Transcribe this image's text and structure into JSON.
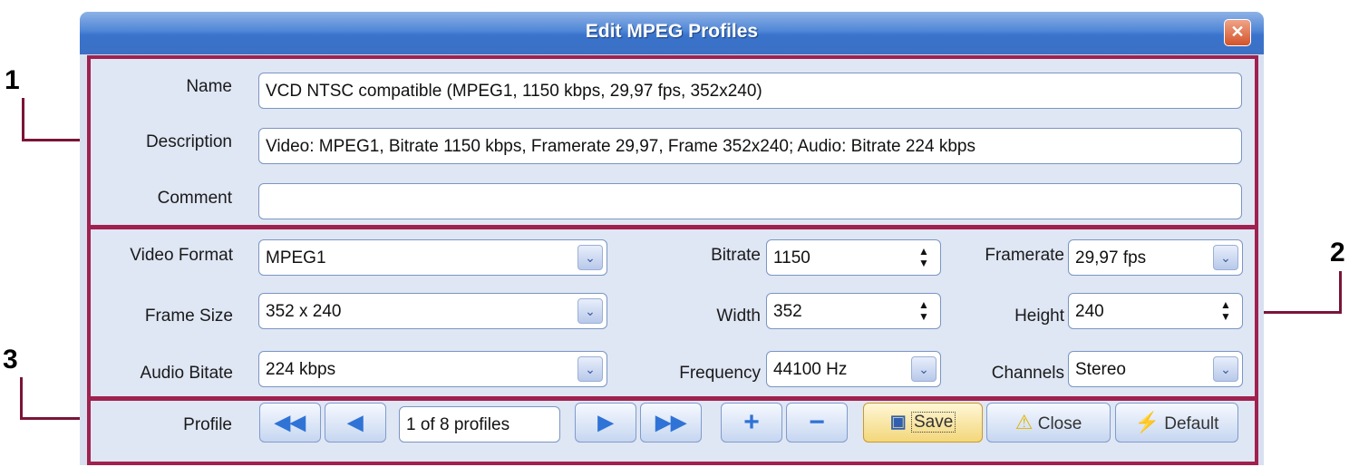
{
  "callouts": {
    "one": "1",
    "two": "2",
    "three": "3"
  },
  "window": {
    "title": "Edit MPEG Profiles",
    "close_glyph": "✕"
  },
  "info": {
    "name_label": "Name",
    "name_value": "VCD NTSC compatible (MPEG1, 1150 kbps, 29,97 fps, 352x240)",
    "description_label": "Description",
    "description_value": "Video: MPEG1, Bitrate 1150 kbps, Framerate 29,97, Frame 352x240; Audio: Bitrate 224 kbps",
    "comment_label": "Comment",
    "comment_value": ""
  },
  "settings": {
    "video_format_label": "Video Format",
    "video_format_value": "MPEG1",
    "bitrate_label": "Bitrate",
    "bitrate_value": "1150",
    "framerate_label": "Framerate",
    "framerate_value": "29,97 fps",
    "frame_size_label": "Frame Size",
    "frame_size_value": "352 x 240",
    "width_label": "Width",
    "width_value": "352",
    "height_label": "Height",
    "height_value": "240",
    "audio_bitate_label": "Audio Bitate",
    "audio_bitate_value": "224 kbps",
    "frequency_label": "Frequency",
    "frequency_value": "44100 Hz",
    "channels_label": "Channels",
    "channels_value": "Stereo"
  },
  "profile": {
    "label": "Profile",
    "counter": "1 of 8 profiles",
    "save_label": "Save",
    "close_label": "Close",
    "default_label": "Default"
  },
  "icons": {
    "first": "◀◀",
    "prev": "◀",
    "next": "▶",
    "last": "▶▶",
    "add": "+",
    "remove": "−",
    "save": "💾",
    "warning": "⚠",
    "default": "⚡",
    "combo": "⌄",
    "spin": "▲▼"
  },
  "colors": {
    "accent": "#a0214e",
    "title_bar": "#4f86d6",
    "button_glyph": "#2f73d6"
  }
}
